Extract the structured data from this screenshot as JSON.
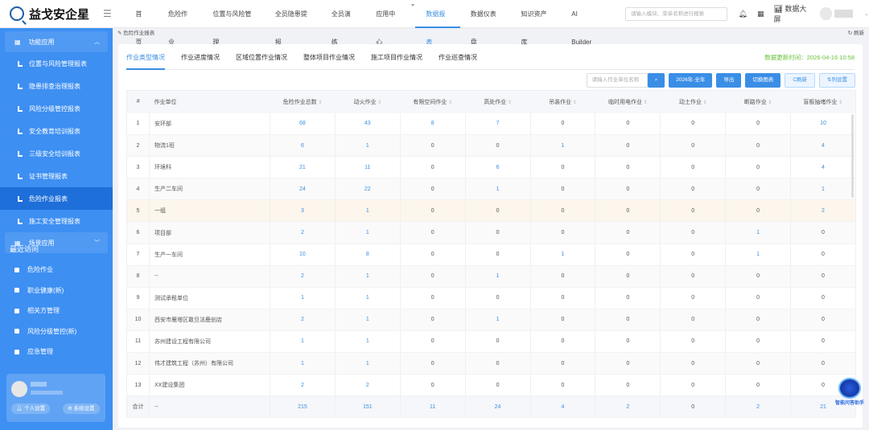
{
  "brand": "益戈安企星",
  "nav": [
    "首页",
    "危险作业",
    "位置与风险管理",
    "全员隐患提报",
    "全员演练",
    "应用中心",
    "数据报表",
    "数据仪表盘",
    "知识资产库",
    "AI Builder"
  ],
  "nav_active": 6,
  "search_placeholder": "请输入模块、菜单名称进行搜索",
  "header_screen": "数据大屏",
  "sidebar": {
    "group1": "功能应用",
    "items": [
      "位置与风险管理报表",
      "隐患排查治理报表",
      "风险分级管控报表",
      "安全教育培训报表",
      "三级安全培训报表",
      "证书管理报表",
      "危险作业报表",
      "施工安全管理报表"
    ],
    "active": 6,
    "group2": "场景应用",
    "recent_title": "最近访问",
    "recent": [
      "危险作业",
      "职业健康(新)",
      "相关方管理",
      "风险分级管控(新)",
      "应急管理"
    ],
    "personal": "个人设置",
    "system": "系统设置"
  },
  "breadcrumb": "危险作业报表",
  "refresh": "刷新",
  "tabs": [
    "作业类型情况",
    "作业进度情况",
    "区域位置作业情况",
    "整体项目作业情况",
    "施工项目作业情况",
    "作业巡查情况"
  ],
  "updated": "数据更新时间：2026-04-16 10:58",
  "toolbar": {
    "placeholder": "请输入作业单位名称",
    "year": "2026年-全年",
    "export": "导出",
    "switch": "切换图表",
    "refresh": "C刷新",
    "columns": "⇅列设置"
  },
  "columns": [
    "#",
    "作业单位",
    "危险作业总数",
    "动火作业",
    "有限空间作业",
    "高处作业",
    "吊装作业",
    "临时用电作业",
    "动土作业",
    "断路作业",
    "盲板抽堵作业"
  ],
  "rows": [
    [
      "1",
      "安环部",
      68,
      43,
      8,
      7,
      0,
      0,
      0,
      0,
      10
    ],
    [
      "2",
      "物流1班",
      6,
      1,
      0,
      0,
      1,
      0,
      0,
      0,
      4
    ],
    [
      "3",
      "环境科",
      21,
      11,
      0,
      6,
      0,
      0,
      0,
      0,
      4
    ],
    [
      "4",
      "生产二车间",
      24,
      22,
      0,
      1,
      0,
      0,
      0,
      0,
      1
    ],
    [
      "5",
      "一组",
      3,
      1,
      0,
      0,
      0,
      0,
      0,
      0,
      2
    ],
    [
      "6",
      "项目部",
      2,
      1,
      0,
      0,
      0,
      0,
      0,
      1,
      0
    ],
    [
      "7",
      "生产一车间",
      10,
      8,
      0,
      0,
      1,
      0,
      0,
      1,
      0
    ],
    [
      "8",
      "--",
      2,
      1,
      0,
      1,
      0,
      0,
      0,
      0,
      0
    ],
    [
      "9",
      "测试承租单位",
      1,
      1,
      0,
      0,
      0,
      0,
      0,
      0,
      0
    ],
    [
      "10",
      "西安市雁塔区敢旦法鹿创店",
      2,
      1,
      0,
      1,
      0,
      0,
      0,
      0,
      0
    ],
    [
      "11",
      "苏州建设工程有限公司",
      1,
      1,
      0,
      0,
      0,
      0,
      0,
      0,
      0
    ],
    [
      "12",
      "伟才建筑工程（苏州）有限公司",
      1,
      1,
      0,
      0,
      0,
      0,
      0,
      0,
      0
    ],
    [
      "13",
      "XX建设集团",
      2,
      2,
      0,
      0,
      0,
      0,
      0,
      0,
      0
    ],
    [
      "合计",
      "--",
      215,
      151,
      11,
      24,
      4,
      2,
      0,
      2,
      21
    ]
  ],
  "assistant": "智能问答助手"
}
